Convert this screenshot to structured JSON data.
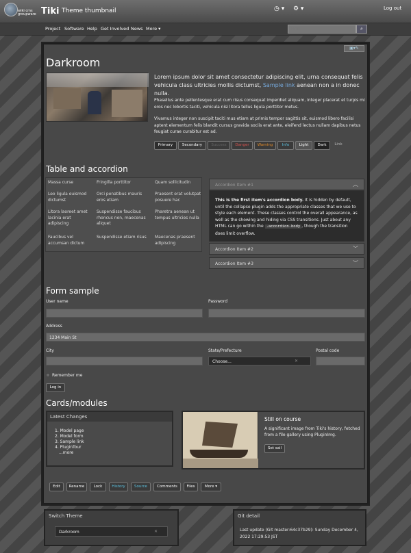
{
  "header": {
    "logo_text": "wiki cms groupware",
    "title": "Tiki",
    "subtitle": "Theme thumbnail",
    "clock_icon": "clock-icon ▾",
    "cog_icon": "cog-icon ▾",
    "logout": "Log out"
  },
  "nav": {
    "items": [
      "Project",
      "Software",
      "Help",
      "Get Involved",
      "News",
      "More ▾"
    ],
    "find_placeholder": "Find",
    "find_icon": "search-icon"
  },
  "toolbar": {
    "icons": [
      "picture-icon",
      "edit-icon"
    ]
  },
  "hero": {
    "title": "Darkroom",
    "lead": "Lorem ipsum dolor sit amet consectetur adipiscing elit, urna consequat felis vehicula class ultricies mollis dictumst,",
    "lead_link": "Sample link",
    "lead_end": "aenean non a in donec nulla.",
    "p1": "Phasellus ante pellentesque erat cum risus consequat imperdiet aliquam, integer placerat et turpis mi eros nec lobortis taciti, vehicula nisi litora tellus ligula porttitor metus.",
    "p2": "Vivamus integer non suscipit taciti mus etiam at primis tempor sagittis sit, euismod libero facilisi aptent elementum felis blandit cursus gravida sociis erat ante, eleifend lectus nullam dapibus netus feugiat curae curabitur est ad.",
    "buttons": [
      "Primary",
      "Secondary",
      "Success",
      "Danger",
      "Warning",
      "Info",
      "Light",
      "Dark"
    ],
    "link_btn": "Link"
  },
  "table_section": {
    "title": "Table and accordion",
    "rows": [
      [
        "Massa curse",
        "Fringilla porttitor",
        "Quam sollicitudin"
      ],
      [
        "Leo ligula euismod dictumst",
        "Orci penatibus mauris eros etiam",
        "Praesent erat volutpat posuere hac"
      ],
      [
        "Litora laoreet amet lacinia erat adipiscing",
        "Suspendisse faucibus rhoncus non, maecenas aliquet",
        "Pharetra aenean ut tempus ultricies nulla"
      ],
      [
        "Faucibus vel accumsan dictum",
        "Suspendisse etiam risus",
        "Maecenas praesent adipiscing"
      ]
    ]
  },
  "accordion": {
    "items": [
      "Accordion Item #1",
      "Accordion Item #2",
      "Accordion Item #3"
    ],
    "body_strong": "This is the first item's accordion body.",
    "body": "It is hidden by default, until the collapse plugin adds the appropriate classes that we use to style each element. These classes control the overall appearance, as well as the showing and hiding via CSS transitions. Just about any HTML can go within the",
    "body_code": ".accordion-body",
    "body_end": ", though the transition does limit overflow."
  },
  "form": {
    "title": "Form sample",
    "user_label": "User name",
    "password_label": "Password",
    "address_label": "Address",
    "address_value": "1234 Main St",
    "city_label": "City",
    "state_label": "State/Prefecture",
    "state_value": "Choose...",
    "postal_label": "Postal code",
    "remember": "Remember me",
    "login": "Log in"
  },
  "cards": {
    "title": "Cards/modules",
    "latest_title": "Latest Changes",
    "latest_items": [
      "1. Model page",
      "2. Model form",
      "3. Sample link",
      "4. PluginTour"
    ],
    "more": "...more",
    "course_title": "Still on course",
    "course_text": "A significant image from Tiki's history, fetched from a file gallery using PluginImg.",
    "course_btn": "Set sail"
  },
  "bottom_buttons": [
    "Edit",
    "Rename",
    "Lock",
    "History",
    "Source",
    "Comments",
    "Files",
    "More ▾"
  ],
  "switch_theme": {
    "title": "Switch Theme",
    "value": "Darkroom"
  },
  "git": {
    "title": "Git detail",
    "text": "Last update (Git master:64c37b29): Sunday December 4, 2022 17:29:53 JST"
  },
  "colors": {
    "success": "#666",
    "danger": "#d9534f",
    "warning": "#e08a2a",
    "info": "#5bc0de",
    "link": "#7ad"
  }
}
